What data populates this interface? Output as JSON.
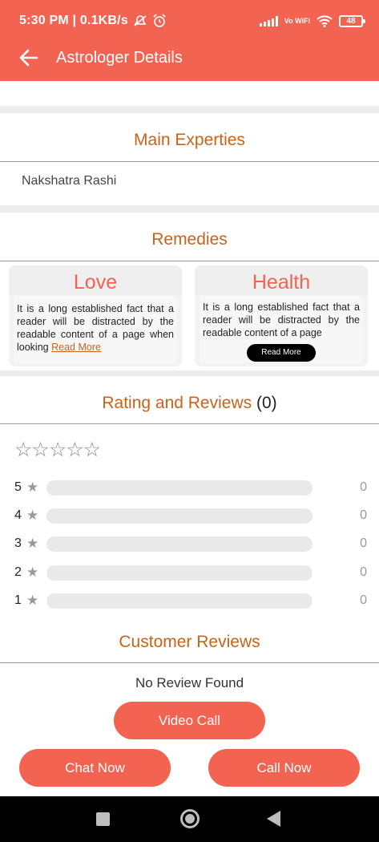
{
  "status_bar": {
    "time": "5:30 PM | 0.1KB/s",
    "network_label": "Vo WiFi",
    "battery": "48"
  },
  "header": {
    "title": "Astrologer Details"
  },
  "main_expertise": {
    "heading": "Main Experties",
    "value": "Nakshatra Rashi"
  },
  "remedies": {
    "heading": "Remedies",
    "cards": [
      {
        "title": "Love",
        "body": "It is a long established fact that a reader will be distracted by the readable content of a page when looking",
        "read_more": "Read More"
      },
      {
        "title": "Health",
        "body": "It is a long established fact that a reader will be distracted by the readable content of a page",
        "read_more": "Read More"
      }
    ]
  },
  "ratings": {
    "heading": "Rating and Reviews",
    "count_label": "(0)",
    "stars_text": "☆☆☆☆☆",
    "rows": [
      {
        "stars": "5",
        "count": "0",
        "fill": 0
      },
      {
        "stars": "4",
        "count": "0",
        "fill": 0
      },
      {
        "stars": "3",
        "count": "0",
        "fill": 0
      },
      {
        "stars": "2",
        "count": "0",
        "fill": 0
      },
      {
        "stars": "1",
        "count": "0",
        "fill": 0
      }
    ]
  },
  "customer_reviews": {
    "heading": "Customer Reviews",
    "empty_text": "No Review Found"
  },
  "actions": {
    "video_call": "Video Call",
    "chat_now": "Chat Now",
    "call_now": "Call Now"
  },
  "colors": {
    "accent": "#f26351",
    "heading": "#c8631b"
  },
  "icons": {
    "back": "arrow-left-icon",
    "star": "star-icon",
    "nav_recents": "square-icon",
    "nav_home": "home-circle-icon",
    "nav_back": "triangle-back-icon"
  }
}
